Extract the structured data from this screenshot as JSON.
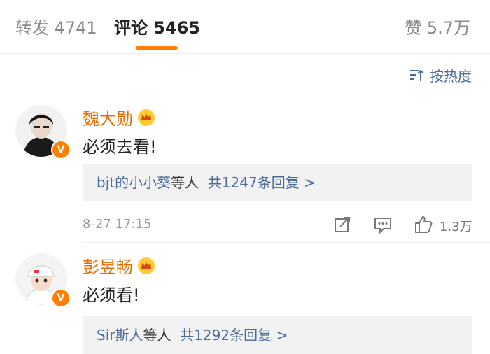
{
  "tabs": {
    "repost_label": "转发 4741",
    "comment_label": "评论 5465",
    "like_label": "赞 5.7万"
  },
  "sort": {
    "label": "按热度",
    "icon": "sort-icon"
  },
  "comments": [
    {
      "author": "魏大勋",
      "text": "必须去看!",
      "reply_users": "bjt的小小葵",
      "reply_suffix": "等人",
      "reply_count": "共1247条回复 >",
      "time": "8-27 17:15",
      "likes": "1.3万"
    },
    {
      "author": "彭昱畅",
      "text": "必须看!",
      "reply_users": "Sir斯人",
      "reply_suffix": "等人",
      "reply_count": "共1292条回复 >"
    }
  ],
  "badges": {
    "verified_symbol": "V"
  },
  "colors": {
    "accent": "#ff8200",
    "link": "#4a6a9a",
    "name": "#e86d00"
  }
}
